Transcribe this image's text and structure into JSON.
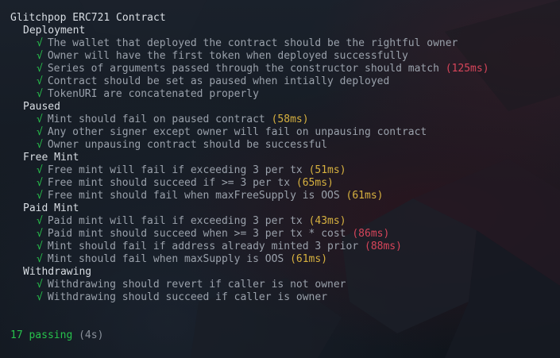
{
  "suite": {
    "title": "Glitchpop ERC721 Contract",
    "check_glyph": "√",
    "groups": [
      {
        "name": "Deployment",
        "tests": [
          {
            "text": "The wallet that deployed the contract should be the rightful owner",
            "duration": ""
          },
          {
            "text": "Owner will have the first token when deployed successfully",
            "duration": ""
          },
          {
            "text": "Series of arguments passed through the constructor should match",
            "duration": "(125ms)",
            "level": "red"
          },
          {
            "text": "Contract should be set as paused when intially deployed",
            "duration": ""
          },
          {
            "text": "TokenURI are concatenated properly",
            "duration": ""
          }
        ]
      },
      {
        "name": "Paused",
        "tests": [
          {
            "text": "Mint should fail on paused contract",
            "duration": "(58ms)",
            "level": "yellow"
          },
          {
            "text": "Any other signer except owner will fail on unpausing contract",
            "duration": ""
          },
          {
            "text": "Owner unpausing contract should be successful",
            "duration": ""
          }
        ]
      },
      {
        "name": "Free Mint",
        "tests": [
          {
            "text": "Free mint will fail if exceeding 3 per tx",
            "duration": "(51ms)",
            "level": "yellow"
          },
          {
            "text": "Free mint should succeed if >= 3 per tx",
            "duration": "(65ms)",
            "level": "yellow"
          },
          {
            "text": "Free mint should fail when maxFreeSupply is OOS",
            "duration": "(61ms)",
            "level": "yellow"
          }
        ]
      },
      {
        "name": "Paid Mint",
        "tests": [
          {
            "text": "Paid mint will fail if exceeding 3 per tx",
            "duration": "(43ms)",
            "level": "yellow"
          },
          {
            "text": "Paid mint should succeed when >= 3 per tx * cost",
            "duration": "(86ms)",
            "level": "red"
          },
          {
            "text": "Mint should fail if address already minted 3 prior",
            "duration": "(88ms)",
            "level": "red"
          },
          {
            "text": "Mint should fail when maxSupply is OOS",
            "duration": "(61ms)",
            "level": "yellow"
          }
        ]
      },
      {
        "name": "Withdrawing",
        "tests": [
          {
            "text": "Withdrawing should revert if caller is not owner",
            "duration": ""
          },
          {
            "text": "Withdrawing should succeed if caller is owner",
            "duration": ""
          }
        ]
      }
    ]
  },
  "summary": {
    "passing": "17 passing",
    "time": "(4s)"
  },
  "colors": {
    "check": "#27c24c",
    "duration_yellow": "#d7b13f",
    "duration_red": "#d7455a",
    "background": "#121821"
  }
}
